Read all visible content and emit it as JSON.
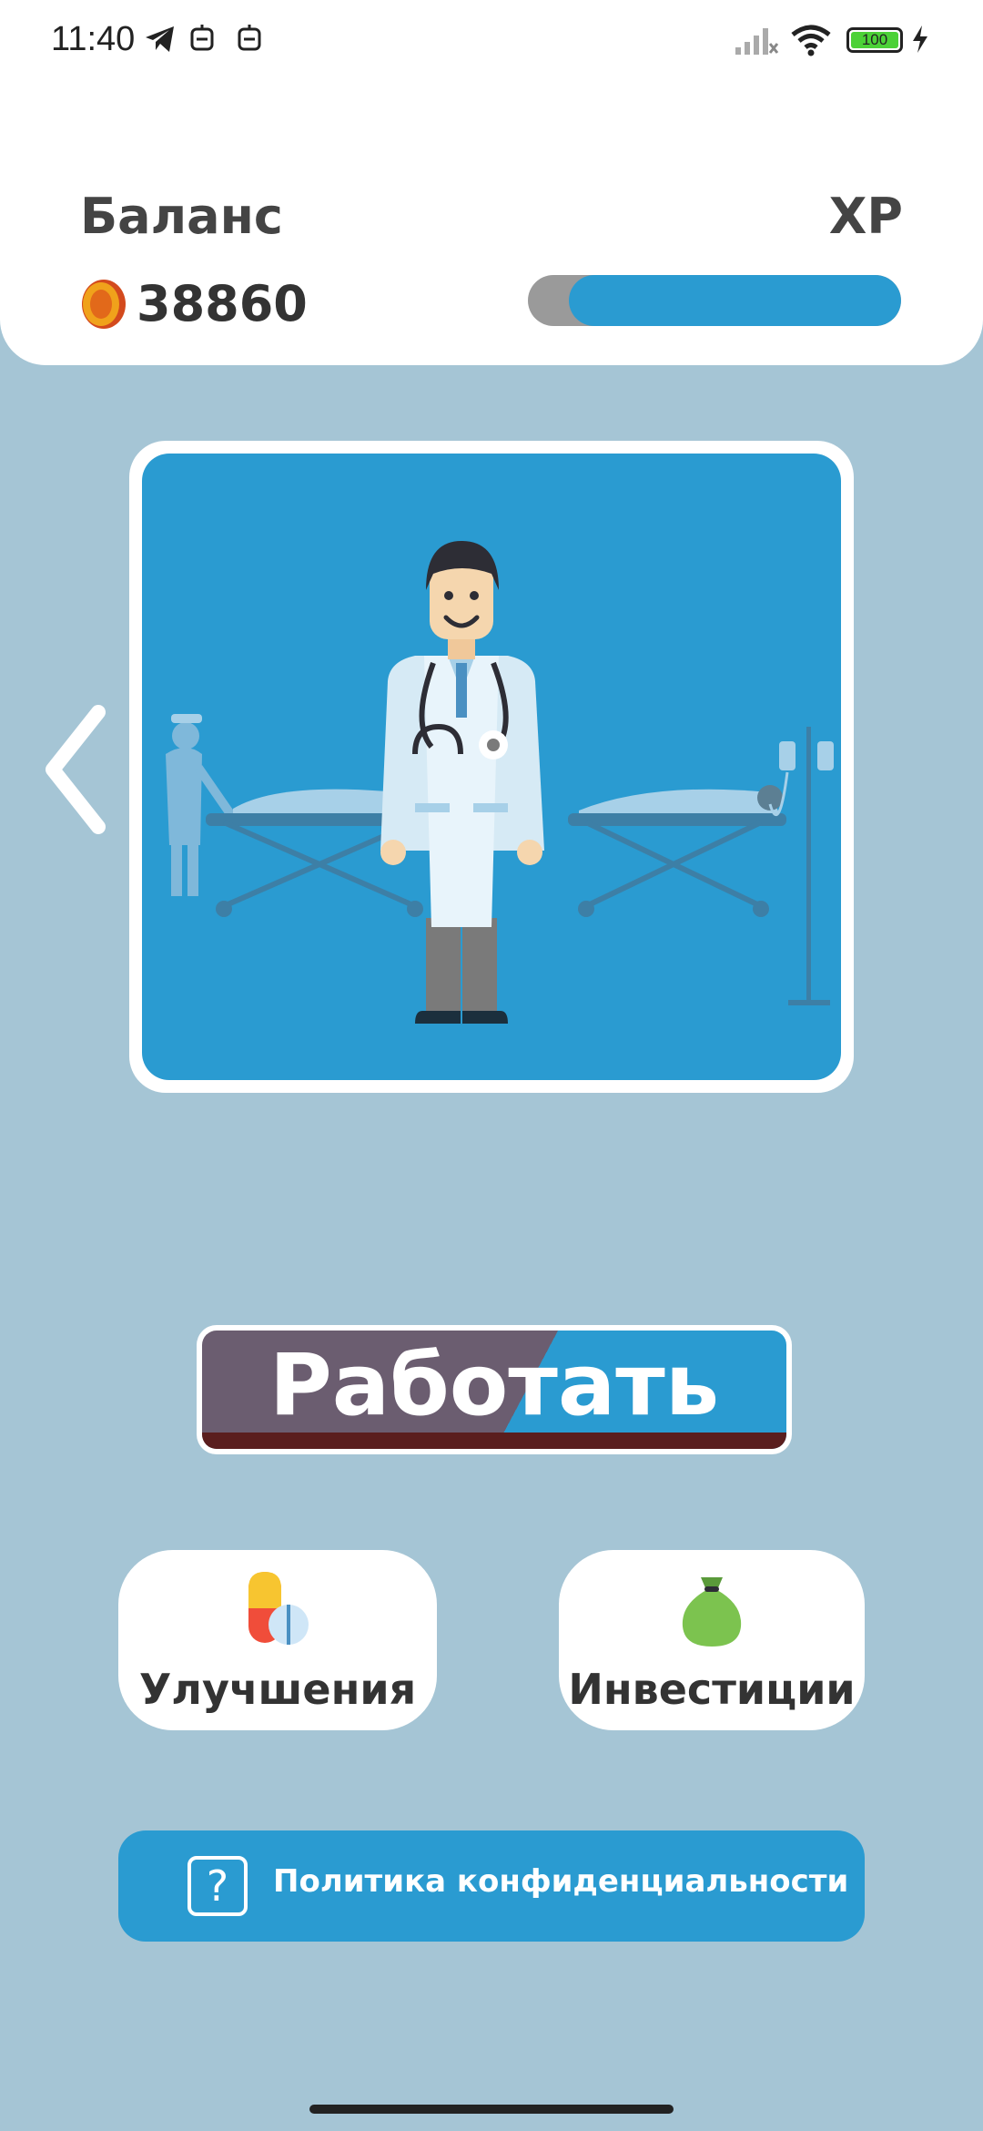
{
  "status_bar": {
    "time": "11:40",
    "battery": "100",
    "icons": [
      "telegram-icon",
      "robot-icon",
      "robot-icon",
      "signal-icon",
      "wifi-icon",
      "battery-icon",
      "charging-icon"
    ]
  },
  "header": {
    "balance_label": "Баланс",
    "balance_value": "38860",
    "xp_label": "XP",
    "xp_progress": 0.89,
    "coin_icon": "coin-icon"
  },
  "scene": {
    "image": "doctor-hospital-illustration",
    "prev_icon": "chevron-left-icon"
  },
  "actions": {
    "work_label": "Работать",
    "upgrades_label": "Улучшения",
    "upgrades_icon": "pill-icon",
    "investments_label": "Инвестиции",
    "investments_icon": "money-bag-icon",
    "privacy_label": "Политика конфиденциальности",
    "privacy_icon": "question-icon"
  },
  "colors": {
    "background": "#a5c5d5",
    "accent": "#2a9bd1",
    "work_button_dark": "#6b5d70"
  }
}
